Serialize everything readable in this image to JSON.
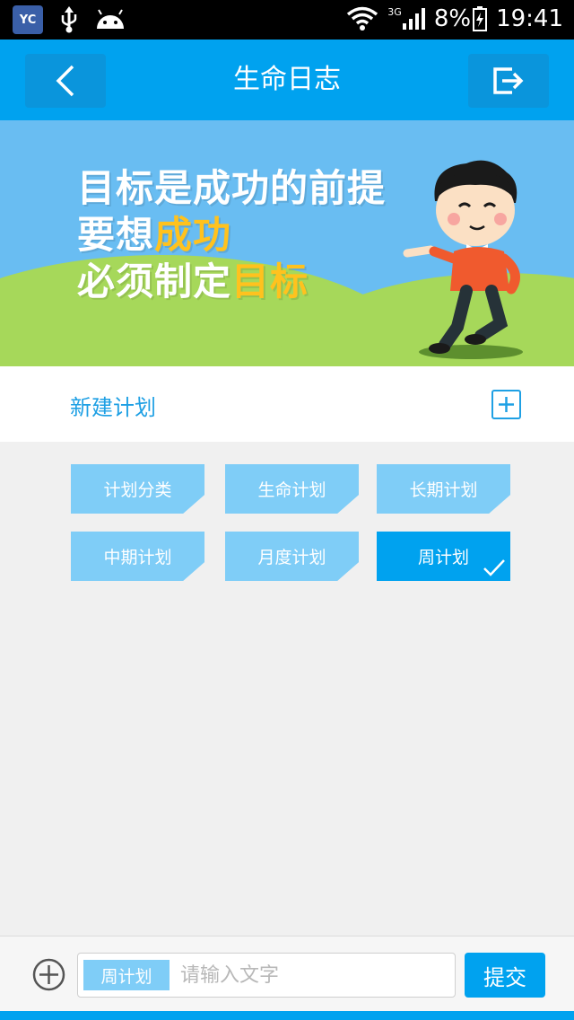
{
  "status_bar": {
    "app_badge": "YC",
    "network": "3G",
    "battery": "8%",
    "time": "19:41"
  },
  "header": {
    "title": "生命日志"
  },
  "banner": {
    "line1": "目标是成功的前提",
    "line2_prefix": "要想",
    "line2_highlight": "成功",
    "line3_prefix": "必须制定",
    "line3_highlight": "目标"
  },
  "new_plan": {
    "label": "新建计划"
  },
  "categories": [
    {
      "label": "计划分类",
      "active": false
    },
    {
      "label": "生命计划",
      "active": false
    },
    {
      "label": "长期计划",
      "active": false
    },
    {
      "label": "中期计划",
      "active": false
    },
    {
      "label": "月度计划",
      "active": false
    },
    {
      "label": "周计划",
      "active": true
    }
  ],
  "bottom_bar": {
    "tag": "周计划",
    "input_placeholder": "请输入文字",
    "submit_label": "提交"
  },
  "colors": {
    "primary": "#00a2ef",
    "light": "#7fcdf7",
    "accent": "#ffc21e"
  }
}
